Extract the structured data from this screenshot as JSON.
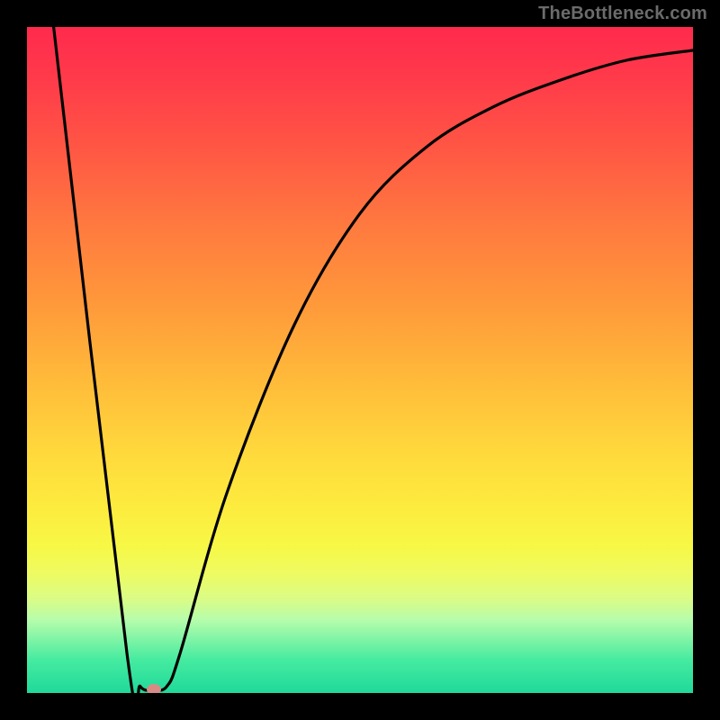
{
  "watermark": "TheBottleneck.com",
  "chart_data": {
    "type": "line",
    "title": "",
    "xlabel": "",
    "ylabel": "",
    "xlim": [
      0,
      100
    ],
    "ylim": [
      0,
      100
    ],
    "series": [
      {
        "name": "bottleneck-curve",
        "x": [
          4,
          15,
          17,
          19,
          21,
          23,
          30,
          40,
          50,
          60,
          70,
          80,
          90,
          100
        ],
        "values": [
          100,
          6,
          1,
          0.5,
          1,
          6,
          30,
          55,
          72,
          82,
          88,
          92,
          95,
          96.5
        ]
      }
    ],
    "marker": {
      "x": 19,
      "y": 0.5
    },
    "background_gradient": {
      "top": "#ff2a4d",
      "mid": "#ffd93c",
      "bottom": "#1fd99a"
    },
    "curve_color": "#000000",
    "marker_color": "#d88a84"
  }
}
